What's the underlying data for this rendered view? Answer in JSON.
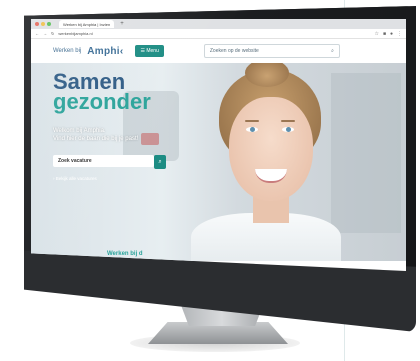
{
  "browser": {
    "tab_title": "Werken bij Amphia | Inzien",
    "new_tab": "+",
    "url": "werkenbijamphia.nl",
    "dot_colors": [
      "#e66a5c",
      "#f0c04b",
      "#5cc05b"
    ]
  },
  "site": {
    "brand_prefix": "Werken bij",
    "brand_name": "Amphi‹",
    "menu_label": "☰ Menu",
    "search_placeholder": "Zoeken op de website",
    "search_icon": "⌕"
  },
  "hero": {
    "headline_line1": "Samen",
    "headline_line2": "gezonder",
    "intro_line1": "Welkom bij Amphia.",
    "intro_line2": "Vind hier de baan die bij je past!",
    "vacancy_search_placeholder": "Zoek vacature",
    "vacancy_search_icon": "⌕",
    "all_vacancies_link": "Bekijk alle vacatures",
    "bottom_teaser": "Werken bij d"
  },
  "colors": {
    "teal": "#1c8c83",
    "blue": "#2e5b85"
  }
}
